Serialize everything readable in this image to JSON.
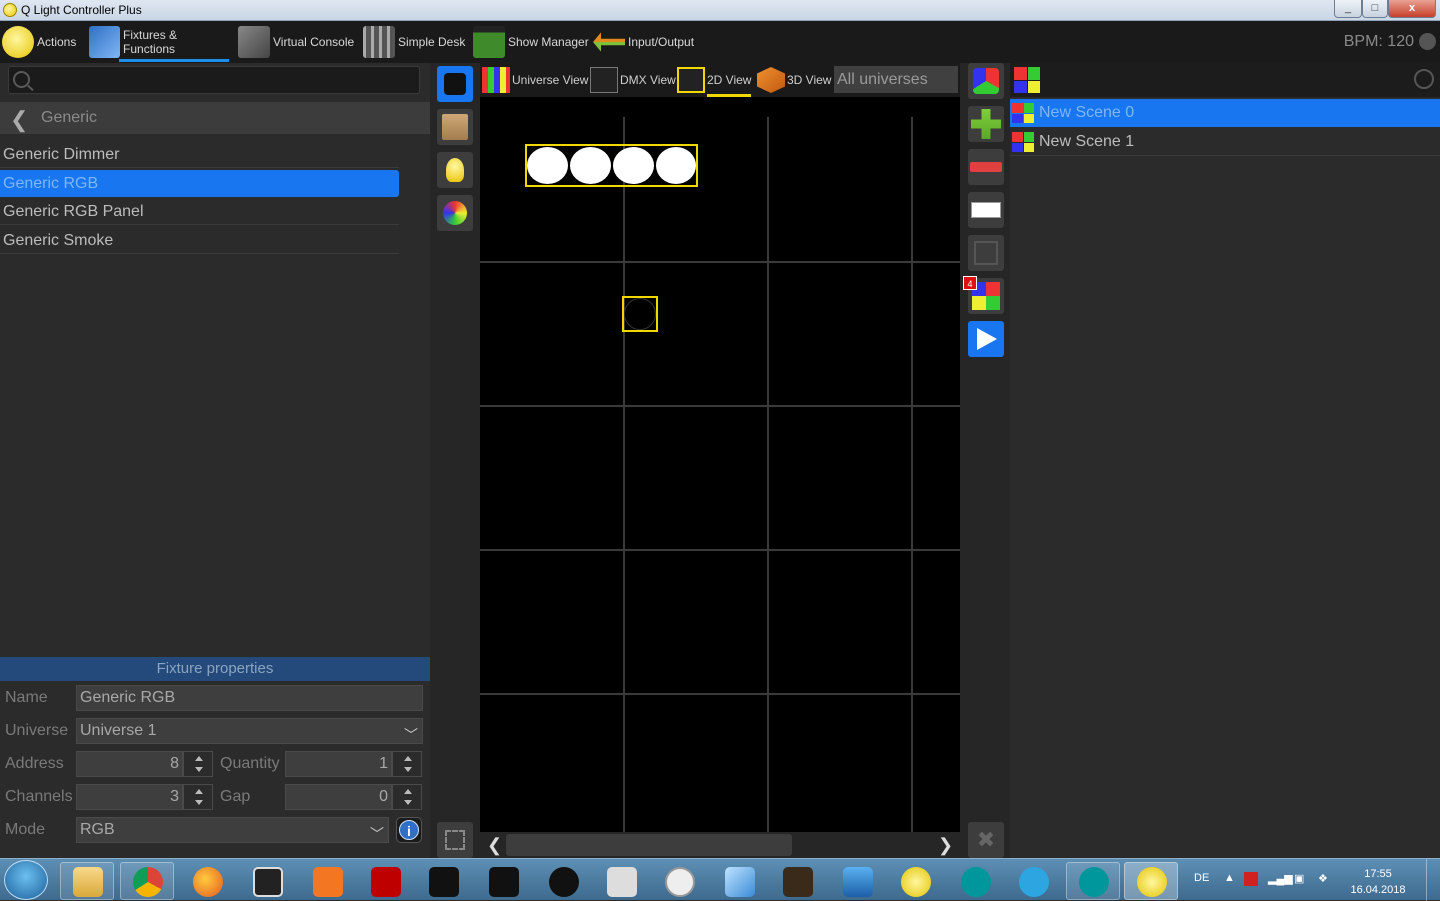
{
  "window": {
    "title": "Q Light Controller Plus",
    "min": "_",
    "max": "□",
    "close": "x"
  },
  "toolbar": {
    "items": [
      {
        "label": "Actions"
      },
      {
        "label": "Fixtures & Functions"
      },
      {
        "label": "Virtual Console"
      },
      {
        "label": "Simple Desk"
      },
      {
        "label": "Show Manager"
      },
      {
        "label": "Input/Output"
      }
    ],
    "bpm": "BPM: 120"
  },
  "left": {
    "breadcrumb": "Generic",
    "fixtures": [
      "Generic Dimmer",
      "Generic RGB",
      "Generic RGB Panel",
      "Generic Smoke"
    ],
    "selected_index": 1
  },
  "properties": {
    "header": "Fixture properties",
    "name_label": "Name",
    "name_value": "Generic RGB",
    "universe_label": "Universe",
    "universe_value": "Universe 1",
    "address_label": "Address",
    "address_value": "8",
    "quantity_label": "Quantity",
    "quantity_value": "1",
    "channels_label": "Channels",
    "channels_value": "3",
    "gap_label": "Gap",
    "gap_value": "0",
    "mode_label": "Mode",
    "mode_value": "RGB",
    "info": "i"
  },
  "views": {
    "tabs": [
      "Universe View",
      "DMX View",
      "2D View",
      "3D View"
    ],
    "active": "2D View",
    "universe_filter": "All universes"
  },
  "canvas_fixtures": {
    "lit_heads": 4,
    "unlit_heads": 1
  },
  "functions": {
    "badge_count": "4"
  },
  "scenes": {
    "items": [
      "New Scene 0",
      "New Scene 1"
    ],
    "selected_index": 0
  },
  "taskbar": {
    "lang": "DE",
    "time": "17:55",
    "date": "16.04.2018"
  },
  "colors": {
    "selection": "#1776f0",
    "fixture_outline": "#f0d800",
    "panel": "#2b2b2b"
  }
}
